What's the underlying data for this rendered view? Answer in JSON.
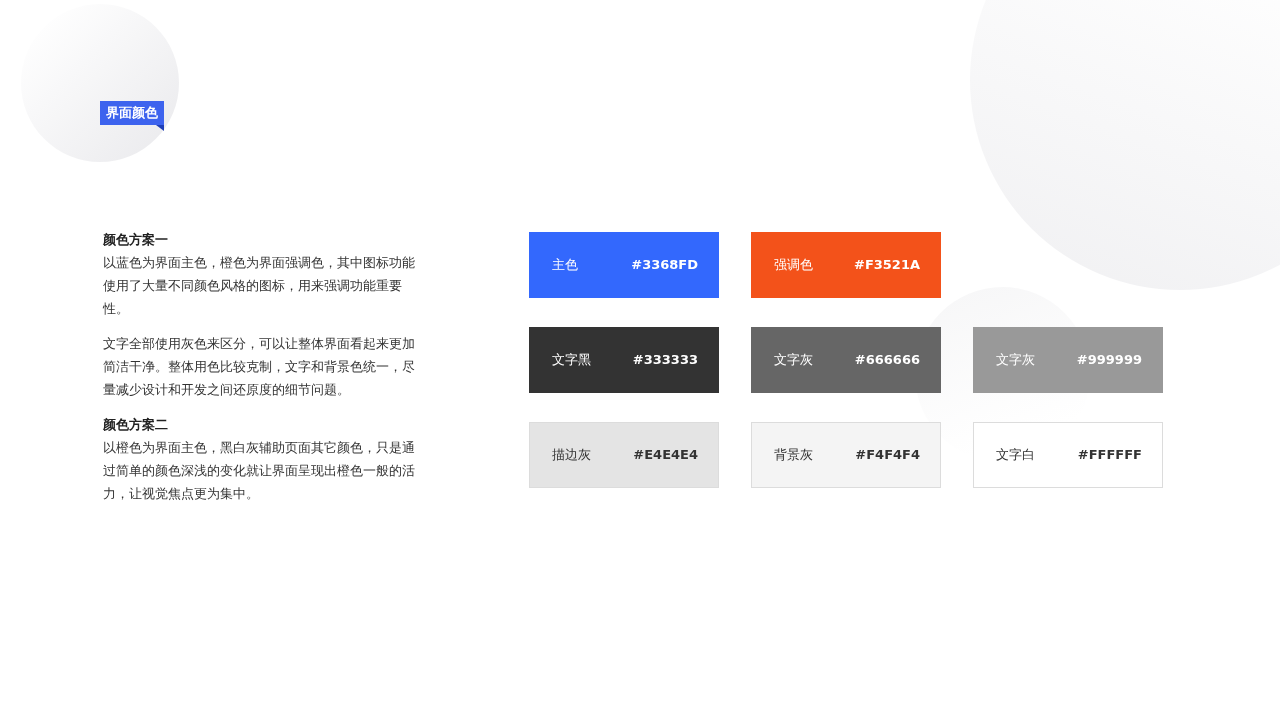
{
  "section_tag": "界面颜色",
  "description": [
    {
      "kind": "heading",
      "text": "颜色方案一"
    },
    {
      "kind": "paragraph",
      "text": "以蓝色为界面主色，橙色为界面强调色，其中图标功能使用了大量不同颜色风格的图标，用来强调功能重要性。"
    },
    {
      "kind": "paragraph",
      "text": "文字全部使用灰色来区分，可以让整体界面看起来更加简洁干净。整体用色比较克制，文字和背景色统一，尽量减少设计和开发之间还原度的细节问题。"
    },
    {
      "kind": "heading",
      "text": "颜色方案二"
    },
    {
      "kind": "paragraph",
      "text": "以橙色为界面主色，黑白灰辅助页面其它颜色，只是通过简单的颜色深浅的变化就让界面呈现出橙色一般的活力，让视觉焦点更为集中。"
    }
  ],
  "swatch_rows": [
    [
      {
        "name": "主色",
        "hex": "#3368FD",
        "color": "#3368fd"
      },
      {
        "name": "强调色",
        "hex": "#F3521A",
        "color": "#f3521a"
      }
    ],
    [
      {
        "name": "文字黑",
        "hex": "#333333",
        "color": "#333333"
      },
      {
        "name": "文字灰",
        "hex": "#666666",
        "color": "#666666"
      },
      {
        "name": "文字灰",
        "hex": "#999999",
        "color": "#999999"
      }
    ],
    [
      {
        "name": "描边灰",
        "hex": "#E4E4E4",
        "color": "#e4e4e4"
      },
      {
        "name": "背景灰",
        "hex": "#F4F4F4",
        "color": "#f4f4f4"
      },
      {
        "name": "文字白",
        "hex": "#FFFFFF",
        "color": "#ffffff"
      }
    ]
  ]
}
